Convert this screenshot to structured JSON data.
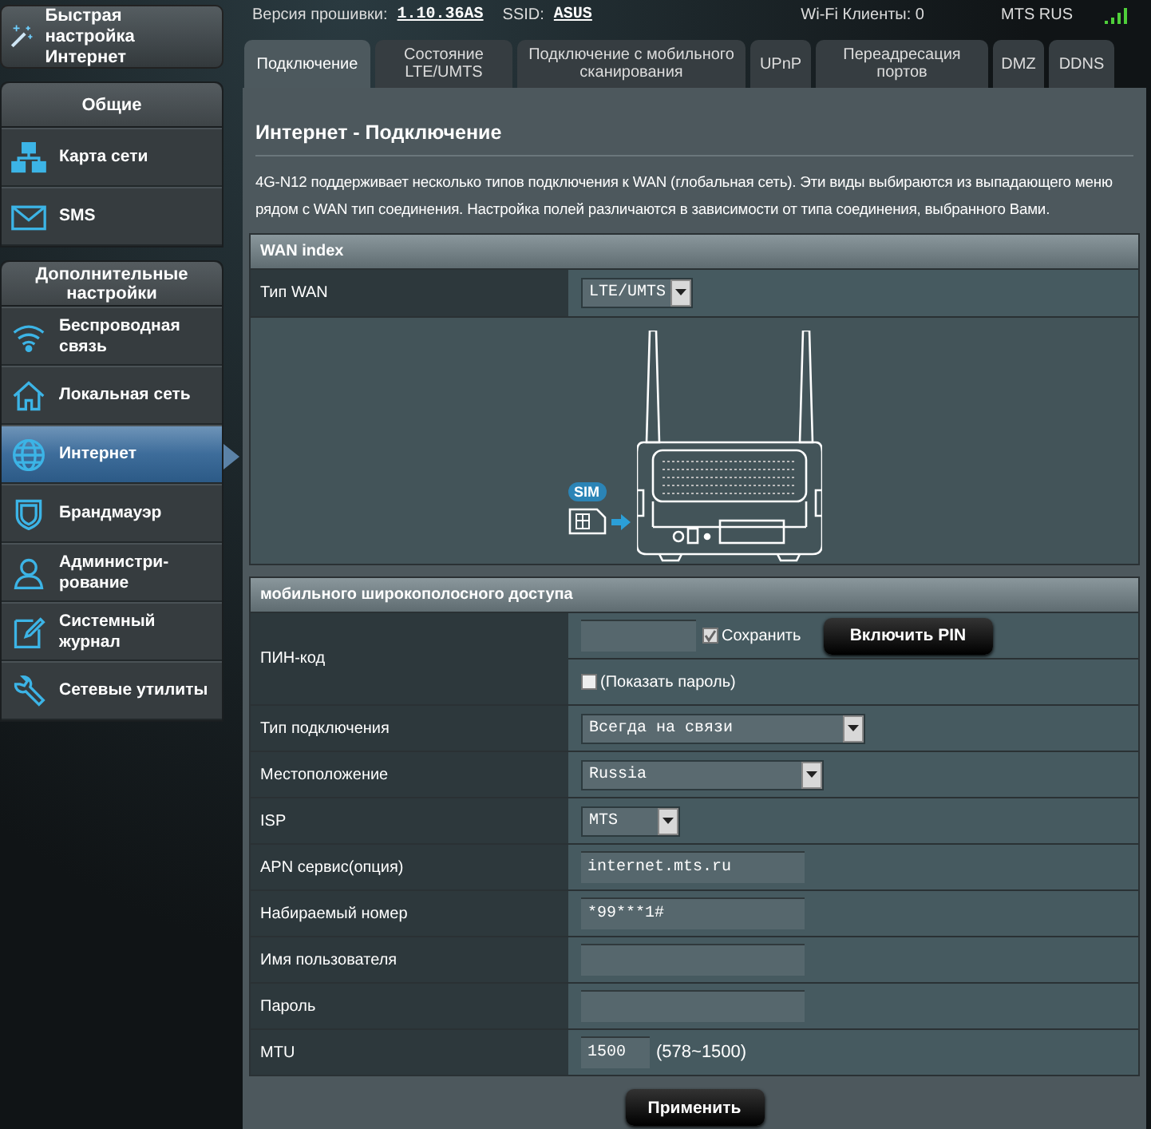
{
  "status_bar": {
    "firmware_label": "Версия прошивки:",
    "firmware": "1.10.36AS",
    "ssid_label": "SSID:",
    "ssid": "ASUS",
    "clients": "Wi-Fi Клиенты: 0",
    "operator": "MTS RUS"
  },
  "quick_setup": {
    "label": "Быстрая настройка Интернет"
  },
  "sidebar": {
    "sections": [
      {
        "title": "Общие",
        "items": [
          {
            "label": "Карта сети",
            "selected": false
          },
          {
            "label": "SMS",
            "selected": false
          }
        ]
      },
      {
        "title": "Дополнительные настройки",
        "items": [
          {
            "label": "Беспроводная связь",
            "selected": false
          },
          {
            "label": "Локальная сеть",
            "selected": false
          },
          {
            "label": "Интернет",
            "selected": true
          },
          {
            "label": "Брандмауэр",
            "selected": false
          },
          {
            "label": "Администри-рование",
            "selected": false
          },
          {
            "label": "Системный журнал",
            "selected": false
          },
          {
            "label": "Сетевые утилиты",
            "selected": false
          }
        ]
      }
    ]
  },
  "tabs": [
    {
      "label": "Подключение",
      "selected": true
    },
    {
      "label": "Состояние LTE/UMTS",
      "selected": false
    },
    {
      "label": "Подключение с мобильного сканирования",
      "selected": false
    },
    {
      "label": "UPnP",
      "selected": false
    },
    {
      "label": "Переадресация портов",
      "selected": false
    },
    {
      "label": "DMZ",
      "selected": false
    },
    {
      "label": "DDNS",
      "selected": false
    }
  ],
  "page": {
    "title": "Интернет - Подключение",
    "description": "4G-N12 поддерживает несколько типов подключения к WAN (глобальная сеть). Эти виды выбираются из выпадающего меню рядом с WAN тип соединения. Настройка полей различаются в зависимости от типа соединения, выбранного Вами."
  },
  "wan_index": {
    "header": "WAN index",
    "wan_type_label": "Тип WAN",
    "wan_type": "LTE/UMTS",
    "sim_label": "SIM"
  },
  "mobile": {
    "header": "мобильного широкополосного доступа",
    "rows": [
      {
        "kind": "pin",
        "label": "ПИН-код",
        "save_label": "Сохранить",
        "save_checked": true,
        "button": "Включить PIN",
        "show_label": "(Показать пароль)",
        "show_checked": false
      },
      {
        "kind": "select",
        "label": "Тип подключения",
        "value": "Всегда на связи"
      },
      {
        "kind": "select",
        "label": "Местоположение",
        "value": "Russia"
      },
      {
        "kind": "select",
        "label": "ISP",
        "value": "MTS"
      },
      {
        "kind": "text",
        "label": "APN сервис(опция)",
        "value": "internet.mts.ru"
      },
      {
        "kind": "text",
        "label": "Набираемый номер",
        "value": "*99***1#"
      },
      {
        "kind": "text",
        "label": "Имя пользователя"
      },
      {
        "kind": "text",
        "label": "Пароль"
      },
      {
        "kind": "mtu",
        "label": "MTU",
        "value": "1500",
        "hint": "(578~1500)"
      }
    ]
  },
  "apply_button": "Применить"
}
